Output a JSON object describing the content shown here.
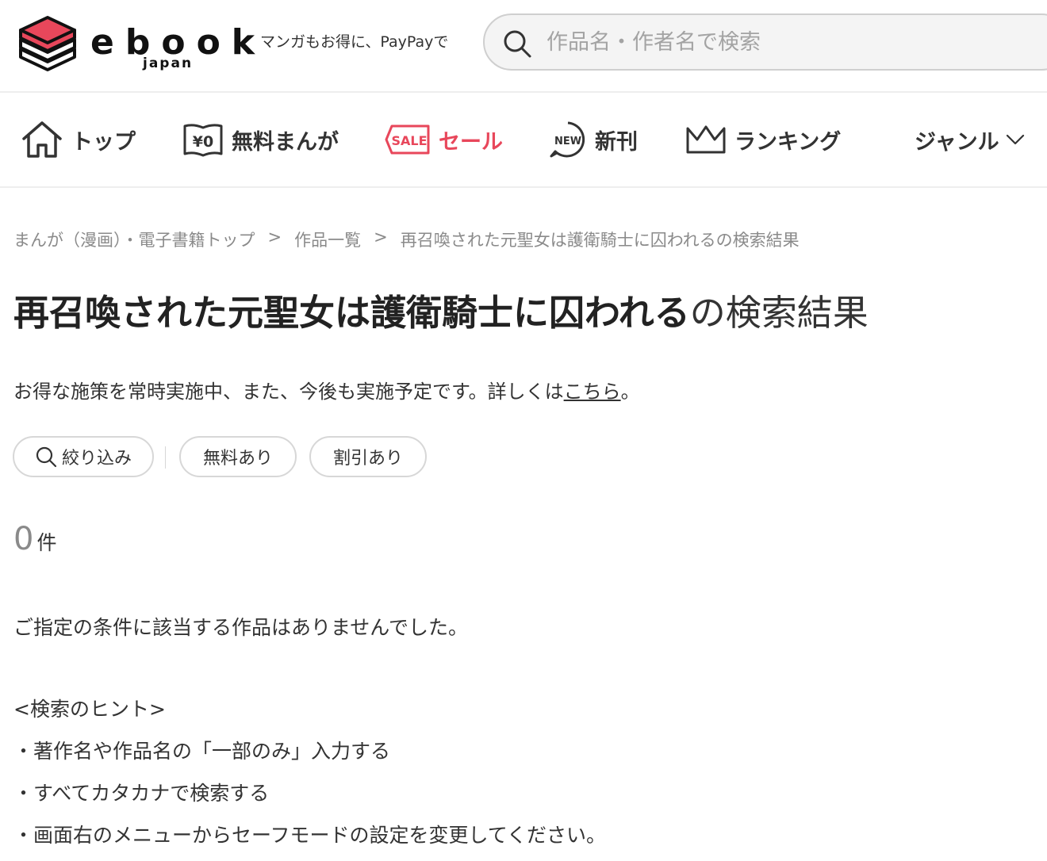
{
  "header": {
    "logo_word": "ebook",
    "logo_sub": "japan",
    "tagline": "マンガもお得に、PayPayで",
    "search_placeholder": "作品名・作者名で検索"
  },
  "nav": {
    "top": "トップ",
    "free_icon_text": "¥0",
    "free": "無料まんが",
    "sale_icon_text": "SALE",
    "sale": "セール",
    "new_icon_text": "NEW",
    "new": "新刊",
    "ranking": "ランキング",
    "genre": "ジャンル"
  },
  "breadcrumb": {
    "items": [
      "まんが（漫画）・電子書籍トップ",
      "作品一覧",
      "再召喚された元聖女は護衛騎士に囚われるの検索結果"
    ],
    "separator": ">"
  },
  "title": {
    "query": "再召喚された元聖女は護衛騎士に囚われる",
    "suffix": "の検索結果"
  },
  "notice": {
    "text": "お得な施策を常時実施中、また、今後も実施予定です。詳しくは",
    "link": "こちら",
    "end": "。"
  },
  "filters": {
    "narrow": "絞り込み",
    "free": "無料あり",
    "discount": "割引あり"
  },
  "results": {
    "count": "0",
    "unit": "件",
    "empty_message": "ご指定の条件に該当する作品はありませんでした。"
  },
  "hints": {
    "heading": "<検索のヒント>",
    "items": [
      "・著作名や作品名の「一部のみ」入力する",
      "・すべてカタカナで検索する",
      "・画面右のメニューからセーフモードの設定を変更してください。"
    ]
  },
  "colors": {
    "brand_red": "#e8475b",
    "text": "#333333",
    "muted": "#8a8a8a"
  }
}
